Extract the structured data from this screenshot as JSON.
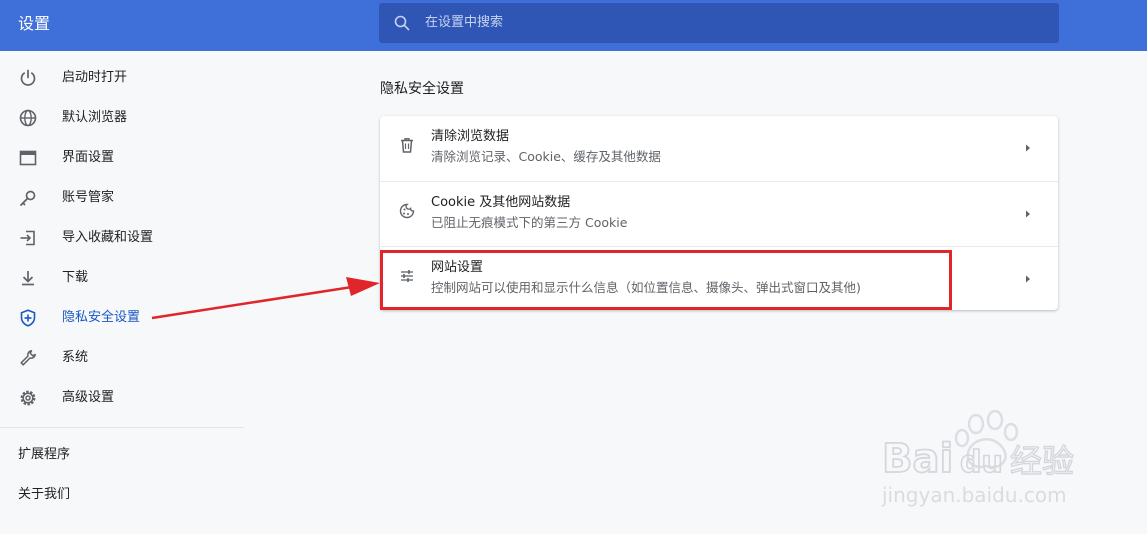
{
  "header": {
    "title": "设置"
  },
  "search": {
    "placeholder": "在设置中搜索",
    "icon": "search-icon"
  },
  "sidebar": {
    "items": [
      {
        "label": "启动时打开",
        "icon": "power-icon"
      },
      {
        "label": "默认浏览器",
        "icon": "globe-icon"
      },
      {
        "label": "界面设置",
        "icon": "window-icon"
      },
      {
        "label": "账号管家",
        "icon": "key-icon"
      },
      {
        "label": "导入收藏和设置",
        "icon": "import-icon"
      },
      {
        "label": "下载",
        "icon": "download-icon"
      },
      {
        "label": "隐私安全设置",
        "icon": "shield-icon",
        "active": true
      },
      {
        "label": "系统",
        "icon": "wrench-icon"
      },
      {
        "label": "高级设置",
        "icon": "gear-icon"
      }
    ],
    "extra": [
      {
        "label": "扩展程序"
      },
      {
        "label": "关于我们"
      }
    ]
  },
  "main": {
    "section_title": "隐私安全设置",
    "rows": [
      {
        "title": "清除浏览数据",
        "subtitle": "清除浏览记录、Cookie、缓存及其他数据",
        "icon": "trash-icon"
      },
      {
        "title": "Cookie 及其他网站数据",
        "subtitle": "已阻止无痕模式下的第三方 Cookie",
        "icon": "cookie-icon"
      },
      {
        "title": "网站设置",
        "subtitle": "控制网站可以使用和显示什么信息（如位置信息、摄像头、弹出式窗口及其他)",
        "icon": "sliders-icon"
      }
    ]
  },
  "watermark": {
    "brand_a": "Bai",
    "brand_b": "du",
    "brand_c": "经验",
    "url": "jingyan.baidu.com"
  },
  "colors": {
    "topbar": "#3f6fd8",
    "search_bg": "#2f56b4",
    "accent": "#1a56c4",
    "highlight": "#e0262b"
  }
}
